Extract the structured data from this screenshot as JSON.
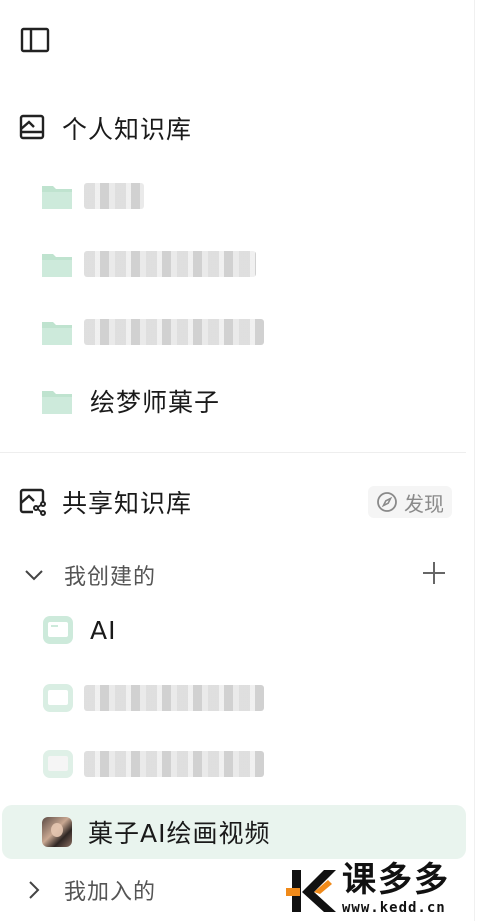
{
  "personal": {
    "title": "个人知识库",
    "folders": [
      {
        "name": "",
        "blurred": true,
        "blur_width": 60
      },
      {
        "name": "",
        "blurred": true,
        "blur_width": 170
      },
      {
        "name": "",
        "blurred": true,
        "blur_width": 180
      },
      {
        "name": "绘梦师菓子",
        "blurred": false
      }
    ]
  },
  "shared": {
    "title": "共享知识库",
    "discover_label": "发现",
    "created_group": {
      "label": "我创建的",
      "items": [
        {
          "name": "AI",
          "blurred": false
        },
        {
          "name": "",
          "blurred": true,
          "blur_width": 180
        },
        {
          "name": "",
          "blurred": true,
          "blur_width": 180
        },
        {
          "name": "菓子AI绘画视频",
          "blurred": false,
          "active": true
        }
      ]
    },
    "joined_group": {
      "label": "我加入的"
    }
  },
  "watermark": {
    "title": "课多多",
    "url": "www.kedd.cn"
  },
  "colors": {
    "folder_green": "#bfe3cf",
    "active_bg": "#e9f4ee",
    "watermark_orange": "#f08a1a"
  },
  "icons": {
    "toggle": "sidebar-toggle-icon",
    "personal": "personal-library-icon",
    "shared": "shared-library-icon",
    "folder": "folder-icon",
    "compass": "compass-icon",
    "chevron_down": "chevron-down-icon",
    "chevron_right": "chevron-right-icon",
    "plus": "plus-icon",
    "library": "library-icon"
  }
}
